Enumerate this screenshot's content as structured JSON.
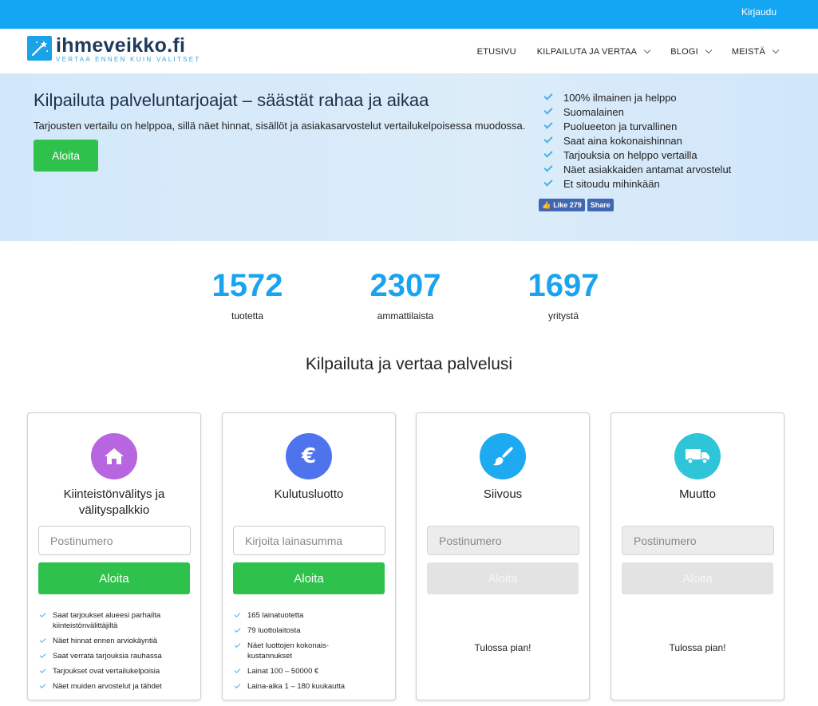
{
  "topbar": {
    "login_label": "Kirjaudu"
  },
  "logo": {
    "name": "ihmeveikko.fi",
    "tagline": "VERTAA ENNEN KUIN VALITSET"
  },
  "nav": [
    {
      "label": "ETUSIVU",
      "dropdown": false
    },
    {
      "label": "KILPAILUTA JA VERTAA",
      "dropdown": true
    },
    {
      "label": "BLOGI",
      "dropdown": true
    },
    {
      "label": "MEISTÄ",
      "dropdown": true
    }
  ],
  "hero": {
    "title": "Kilpailuta palveluntarjoajat – säästät rahaa ja aikaa",
    "subtitle": "Tarjousten vertailu on helppoa, sillä näet hinnat, sisällöt ja asiakasarvostelut vertailukelpoisessa muodossa.",
    "button_label": "Aloita",
    "features": [
      "100% ilmainen ja helppo",
      "Suomalainen",
      "Puolueeton ja turvallinen",
      "Saat aina kokonaishinnan",
      "Tarjouksia on helppo vertailla",
      "Näet asiakkaiden antamat arvostelut",
      "Et sitoudu mihinkään"
    ],
    "fb_like_label": "Like 279",
    "fb_share_label": "Share"
  },
  "stats": [
    {
      "number": "1572",
      "label": "tuotetta"
    },
    {
      "number": "2307",
      "label": "ammattilaista"
    },
    {
      "number": "1697",
      "label": "yritystä"
    }
  ],
  "section_title": "Kilpailuta ja vertaa palvelusi",
  "cards": [
    {
      "title": "Kiinteistönvälitys ja välityspalkkio",
      "icon": "house-icon",
      "icon_color": "#b865e0",
      "placeholder": "Postinumero",
      "button_label": "Aloita",
      "enabled": true,
      "bullets": [
        "Saat tarjoukset alueesi parhailta kiinteistönvälittäjiltä",
        "Näet hinnat ennen arviokäyntiä",
        "Saat verrata tarjouksia rauhassa",
        "Tarjoukset ovat vertailukelpoisia",
        "Näet muiden arvostelut ja tähdet"
      ]
    },
    {
      "title": "Kulutusluotto",
      "icon": "euro-icon",
      "icon_color": "#4f73ec",
      "placeholder": "Kirjoita lainasumma",
      "button_label": "Aloita",
      "enabled": true,
      "bullets": [
        "165 lainatuotetta",
        "79 luottolaitosta",
        "Näet luottojen kokonais-kustannukset",
        "Lainat 100 – 50000 €",
        "Laina-aika 1 – 180 kuukautta"
      ]
    },
    {
      "title": "Siivous",
      "icon": "brush-icon",
      "icon_color": "#1eaaf1",
      "placeholder": "Postinumero",
      "button_label": "Aloita",
      "enabled": false,
      "soon_label": "Tulossa pian!"
    },
    {
      "title": "Muutto",
      "icon": "truck-icon",
      "icon_color": "#2ec5d8",
      "placeholder": "Postinumero",
      "button_label": "Aloita",
      "enabled": false,
      "soon_label": "Tulossa pian!"
    }
  ],
  "colors": {
    "topbar": "#12a6f3",
    "accent_green": "#2ec14b",
    "stat_blue": "#1aa3ef",
    "brand_dark": "#1e3a5a"
  }
}
